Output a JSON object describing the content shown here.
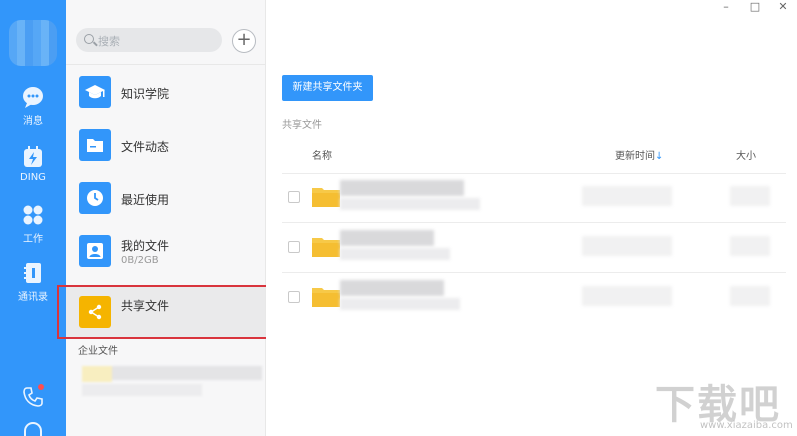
{
  "window": {
    "minimize": "–",
    "maximize": "□",
    "close": "✕"
  },
  "rail": {
    "items": [
      {
        "label": "消息",
        "icon": "chat-icon"
      },
      {
        "label": "DING",
        "icon": "ding-icon"
      },
      {
        "label": "工作",
        "icon": "work-grid-icon"
      },
      {
        "label": "通讯录",
        "icon": "contacts-icon"
      }
    ],
    "accent": "#3296fa"
  },
  "search": {
    "placeholder": "搜索"
  },
  "nav": {
    "items": [
      {
        "label": "知识学院",
        "icon": "graduation-cap-icon"
      },
      {
        "label": "文件动态",
        "icon": "folder-activity-icon"
      },
      {
        "label": "最近使用",
        "icon": "clock-icon"
      },
      {
        "label": "我的文件",
        "sub": "0B/2GB",
        "icon": "user-icon"
      },
      {
        "label": "共享文件",
        "icon": "share-icon",
        "active": true
      }
    ],
    "enterprise_title": "企业文件"
  },
  "main": {
    "new_button": "新建共享文件夹",
    "section_title": "共享文件",
    "columns": {
      "name": "名称",
      "time": "更新时间",
      "time_arrow": "↓",
      "size": "大小"
    }
  },
  "watermark": {
    "text": "下载吧",
    "sub": "www.xiazaiba.com"
  },
  "colors": {
    "active_tile": "#f5b400",
    "highlight": "#d9343d",
    "folder": "#f7c948"
  }
}
